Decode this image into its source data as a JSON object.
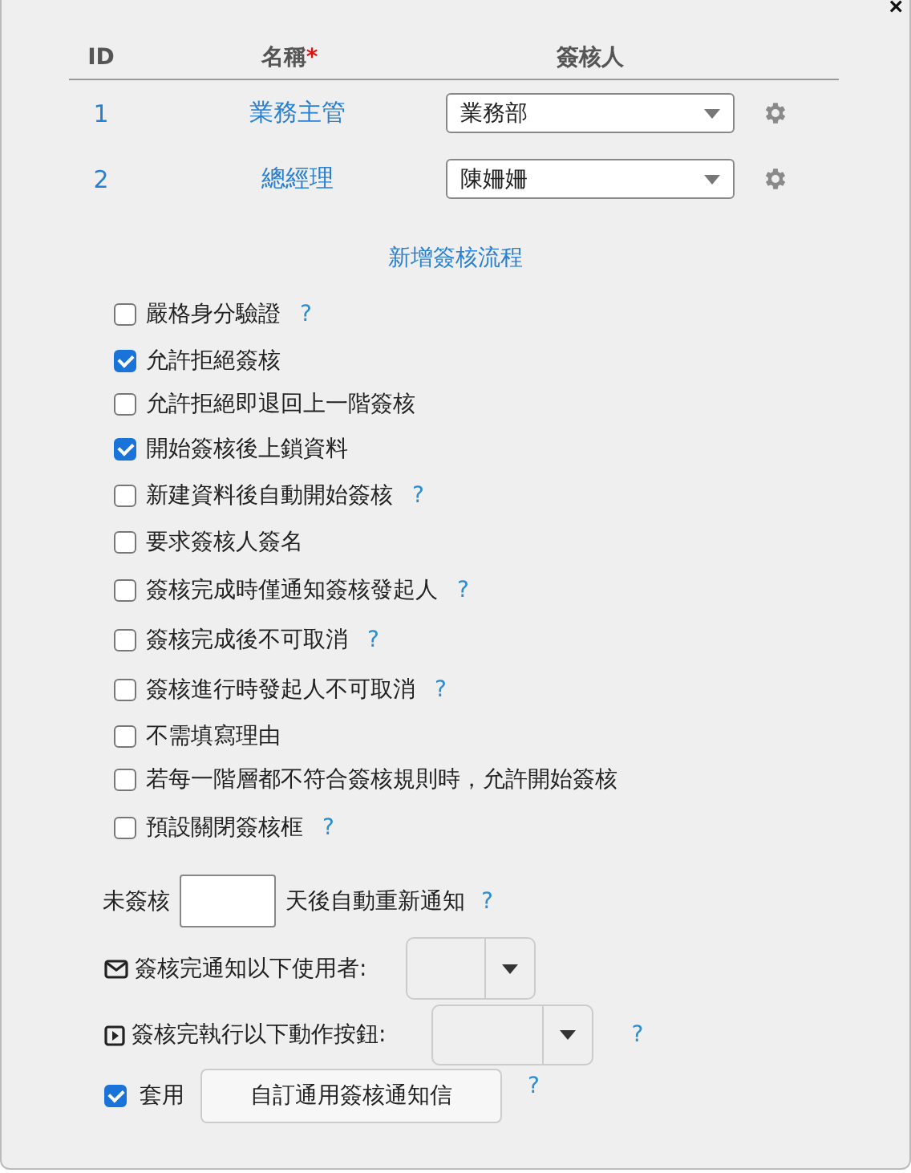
{
  "close_label": "×",
  "table": {
    "columns": [
      {
        "label": "ID"
      },
      {
        "label": "名稱",
        "required": true,
        "marker": "*"
      },
      {
        "label": "簽核人"
      }
    ],
    "rows": [
      {
        "id": "1",
        "name": "業務主管",
        "approver": "業務部"
      },
      {
        "id": "2",
        "name": "總經理",
        "approver": "陳姍姍"
      }
    ]
  },
  "add_link": "新增簽核流程",
  "options": [
    {
      "label": "嚴格身分驗證",
      "checked": false,
      "help": "?"
    },
    {
      "label": "允許拒絕簽核",
      "checked": true
    },
    {
      "label": "允許拒絕即退回上一階簽核",
      "checked": false
    },
    {
      "label": "開始簽核後上鎖資料",
      "checked": true
    },
    {
      "label": "新建資料後自動開始簽核",
      "checked": false,
      "help": "?"
    },
    {
      "label": "要求簽核人簽名",
      "checked": false
    },
    {
      "label": "簽核完成時僅通知簽核發起人",
      "checked": false,
      "help": "?"
    },
    {
      "label": "簽核完成後不可取消",
      "checked": false,
      "help": "?"
    },
    {
      "label": "簽核進行時發起人不可取消",
      "checked": false,
      "help": "?"
    },
    {
      "label": "不需填寫理由",
      "checked": false
    },
    {
      "label": "若每一階層都不符合簽核規則時，允許開始簽核",
      "checked": false
    },
    {
      "label": "預設關閉簽核框",
      "checked": false,
      "help": "?"
    }
  ],
  "remind": {
    "before": "未簽核",
    "after": "天後自動重新通知",
    "help": "?"
  },
  "notify_users": {
    "label": "簽核完通知以下使用者:"
  },
  "run_action": {
    "label": "簽核完執行以下動作按鈕:",
    "help": "?"
  },
  "apply": {
    "checked": true,
    "label": "套用",
    "button": "自訂通用簽核通知信",
    "help": "?"
  }
}
